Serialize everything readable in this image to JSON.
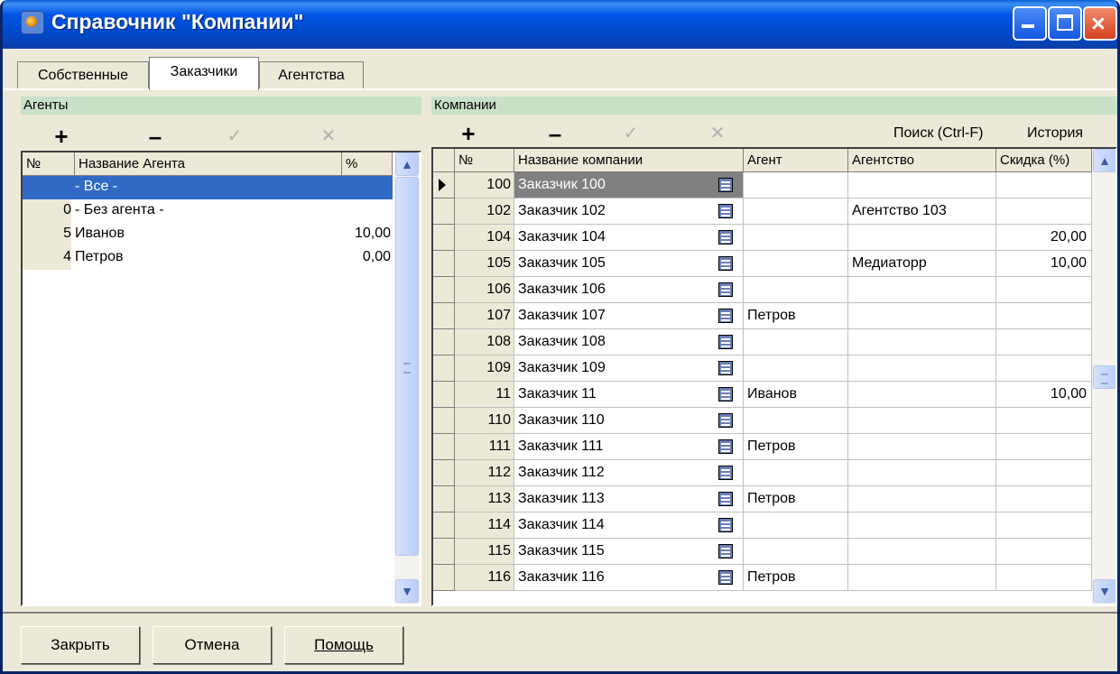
{
  "window": {
    "title": "Справочник \"Компании\""
  },
  "tabs": [
    {
      "label": "Собственные"
    },
    {
      "label": "Заказчики"
    },
    {
      "label": "Агентства"
    }
  ],
  "agents": {
    "header": "Агенты",
    "columns": {
      "num": "№",
      "name": "Название Агента",
      "percent": "%"
    },
    "rows": [
      {
        "num": "",
        "name": "- Все -",
        "percent": ""
      },
      {
        "num": "0",
        "name": "- Без агента -",
        "percent": ""
      },
      {
        "num": "5",
        "name": "Иванов",
        "percent": "10,00"
      },
      {
        "num": "4",
        "name": "Петров",
        "percent": "0,00"
      }
    ]
  },
  "companies": {
    "header": "Компании",
    "search_label": "Поиск (Ctrl-F)",
    "history_label": "История",
    "columns": {
      "num": "№",
      "name": "Название компании",
      "agent": "Агент",
      "agency": "Агентство",
      "discount": "Скидка (%)"
    },
    "rows": [
      {
        "num": "100",
        "name": "Заказчик 100",
        "agent": "",
        "agency": "",
        "discount": ""
      },
      {
        "num": "102",
        "name": "Заказчик 102",
        "agent": "",
        "agency": "Агентство 103",
        "discount": ""
      },
      {
        "num": "104",
        "name": "Заказчик 104",
        "agent": "",
        "agency": "",
        "discount": "20,00"
      },
      {
        "num": "105",
        "name": "Заказчик 105",
        "agent": "",
        "agency": "Медиаторр",
        "discount": "10,00"
      },
      {
        "num": "106",
        "name": "Заказчик 106",
        "agent": "",
        "agency": "",
        "discount": ""
      },
      {
        "num": "107",
        "name": "Заказчик 107",
        "agent": "Петров",
        "agency": "",
        "discount": ""
      },
      {
        "num": "108",
        "name": "Заказчик 108",
        "agent": "",
        "agency": "",
        "discount": ""
      },
      {
        "num": "109",
        "name": "Заказчик 109",
        "agent": "",
        "agency": "",
        "discount": ""
      },
      {
        "num": "11",
        "name": "Заказчик 11",
        "agent": "Иванов",
        "agency": "",
        "discount": "10,00"
      },
      {
        "num": "110",
        "name": "Заказчик 110",
        "agent": "",
        "agency": "",
        "discount": ""
      },
      {
        "num": "111",
        "name": "Заказчик 111",
        "agent": "Петров",
        "agency": "",
        "discount": ""
      },
      {
        "num": "112",
        "name": "Заказчик 112",
        "agent": "",
        "agency": "",
        "discount": ""
      },
      {
        "num": "113",
        "name": "Заказчик 113",
        "agent": "Петров",
        "agency": "",
        "discount": ""
      },
      {
        "num": "114",
        "name": "Заказчик 114",
        "agent": "",
        "agency": "",
        "discount": ""
      },
      {
        "num": "115",
        "name": "Заказчик 115",
        "agent": "",
        "agency": "",
        "discount": ""
      },
      {
        "num": "116",
        "name": "Заказчик 116",
        "agent": "Петров",
        "agency": "",
        "discount": ""
      }
    ]
  },
  "buttons": {
    "close": "Закрыть",
    "cancel": "Отмена",
    "help": "Помощь"
  }
}
